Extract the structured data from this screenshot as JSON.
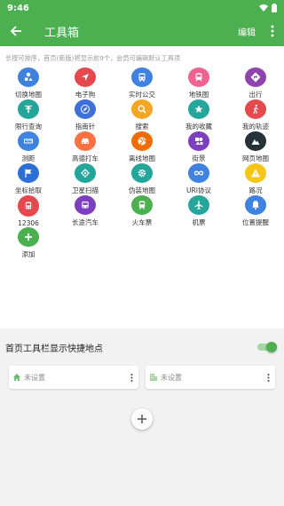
{
  "status": {
    "time": "9:46"
  },
  "appbar": {
    "title": "工具箱",
    "edit_label": "编辑"
  },
  "hint": "长按可排序，首页(新版)将显示前9个，会员可编辑默认工具项",
  "colors": {
    "primary": "#4caf50"
  },
  "tools": [
    {
      "label": "切换地图",
      "icon": "shapes-icon",
      "color": "#3f82e0"
    },
    {
      "label": "电子狗",
      "icon": "navigation-arrow-icon",
      "color": "#e5484d"
    },
    {
      "label": "实时公交",
      "icon": "bus-icon",
      "color": "#3f82e0"
    },
    {
      "label": "地铁图",
      "icon": "subway-icon",
      "color": "#f06292"
    },
    {
      "label": "出行",
      "icon": "directions-icon",
      "color": "#8e44ad"
    },
    {
      "label": "限行查询",
      "icon": "restriction-icon",
      "color": "#26a69a"
    },
    {
      "label": "指南针",
      "icon": "compass-icon",
      "color": "#3f6fd8"
    },
    {
      "label": "搜索",
      "icon": "search-icon",
      "color": "#f5a623"
    },
    {
      "label": "我的收藏",
      "icon": "star-icon",
      "color": "#26a69a"
    },
    {
      "label": "我的轨迹",
      "icon": "walk-icon",
      "color": "#e5484d"
    },
    {
      "label": "测距",
      "icon": "ruler-icon",
      "color": "#3f82e0"
    },
    {
      "label": "高德打车",
      "icon": "car-icon",
      "color": "#ff7043"
    },
    {
      "label": "离线地图",
      "icon": "globe-icon",
      "color": "#ef6c00"
    },
    {
      "label": "街景",
      "icon": "street-view-icon",
      "color": "#7b3fbf"
    },
    {
      "label": "网页地图",
      "icon": "mountain-icon",
      "color": "#263238"
    },
    {
      "label": "坐标拾取",
      "icon": "flag-icon",
      "color": "#2d6fd6"
    },
    {
      "label": "卫星扫描",
      "icon": "gps-fixed-icon",
      "color": "#26a69a"
    },
    {
      "label": "伪装地图",
      "icon": "gear-icon",
      "color": "#26a69a"
    },
    {
      "label": "URI协议",
      "icon": "infinity-icon",
      "color": "#3f82e0"
    },
    {
      "label": "路况",
      "icon": "warning-icon",
      "color": "#f5c518"
    },
    {
      "label": "12306",
      "icon": "train-icon",
      "color": "#e5484d"
    },
    {
      "label": "长途汽车",
      "icon": "coach-icon",
      "color": "#7b3fbf"
    },
    {
      "label": "火车票",
      "icon": "rail-ticket-icon",
      "color": "#4caf50"
    },
    {
      "label": "机票",
      "icon": "airplane-icon",
      "color": "#26a69a"
    },
    {
      "label": "位置提醒",
      "icon": "bell-icon",
      "color": "#3f82e0"
    },
    {
      "label": "添加",
      "icon": "plus-icon",
      "color": "#4caf50"
    }
  ],
  "quick": {
    "title": "首页工具栏显示快捷地点",
    "enabled": true,
    "slots": [
      {
        "label": "未设置",
        "icon": "home-icon"
      },
      {
        "label": "未设置",
        "icon": "office-building-icon"
      }
    ]
  }
}
